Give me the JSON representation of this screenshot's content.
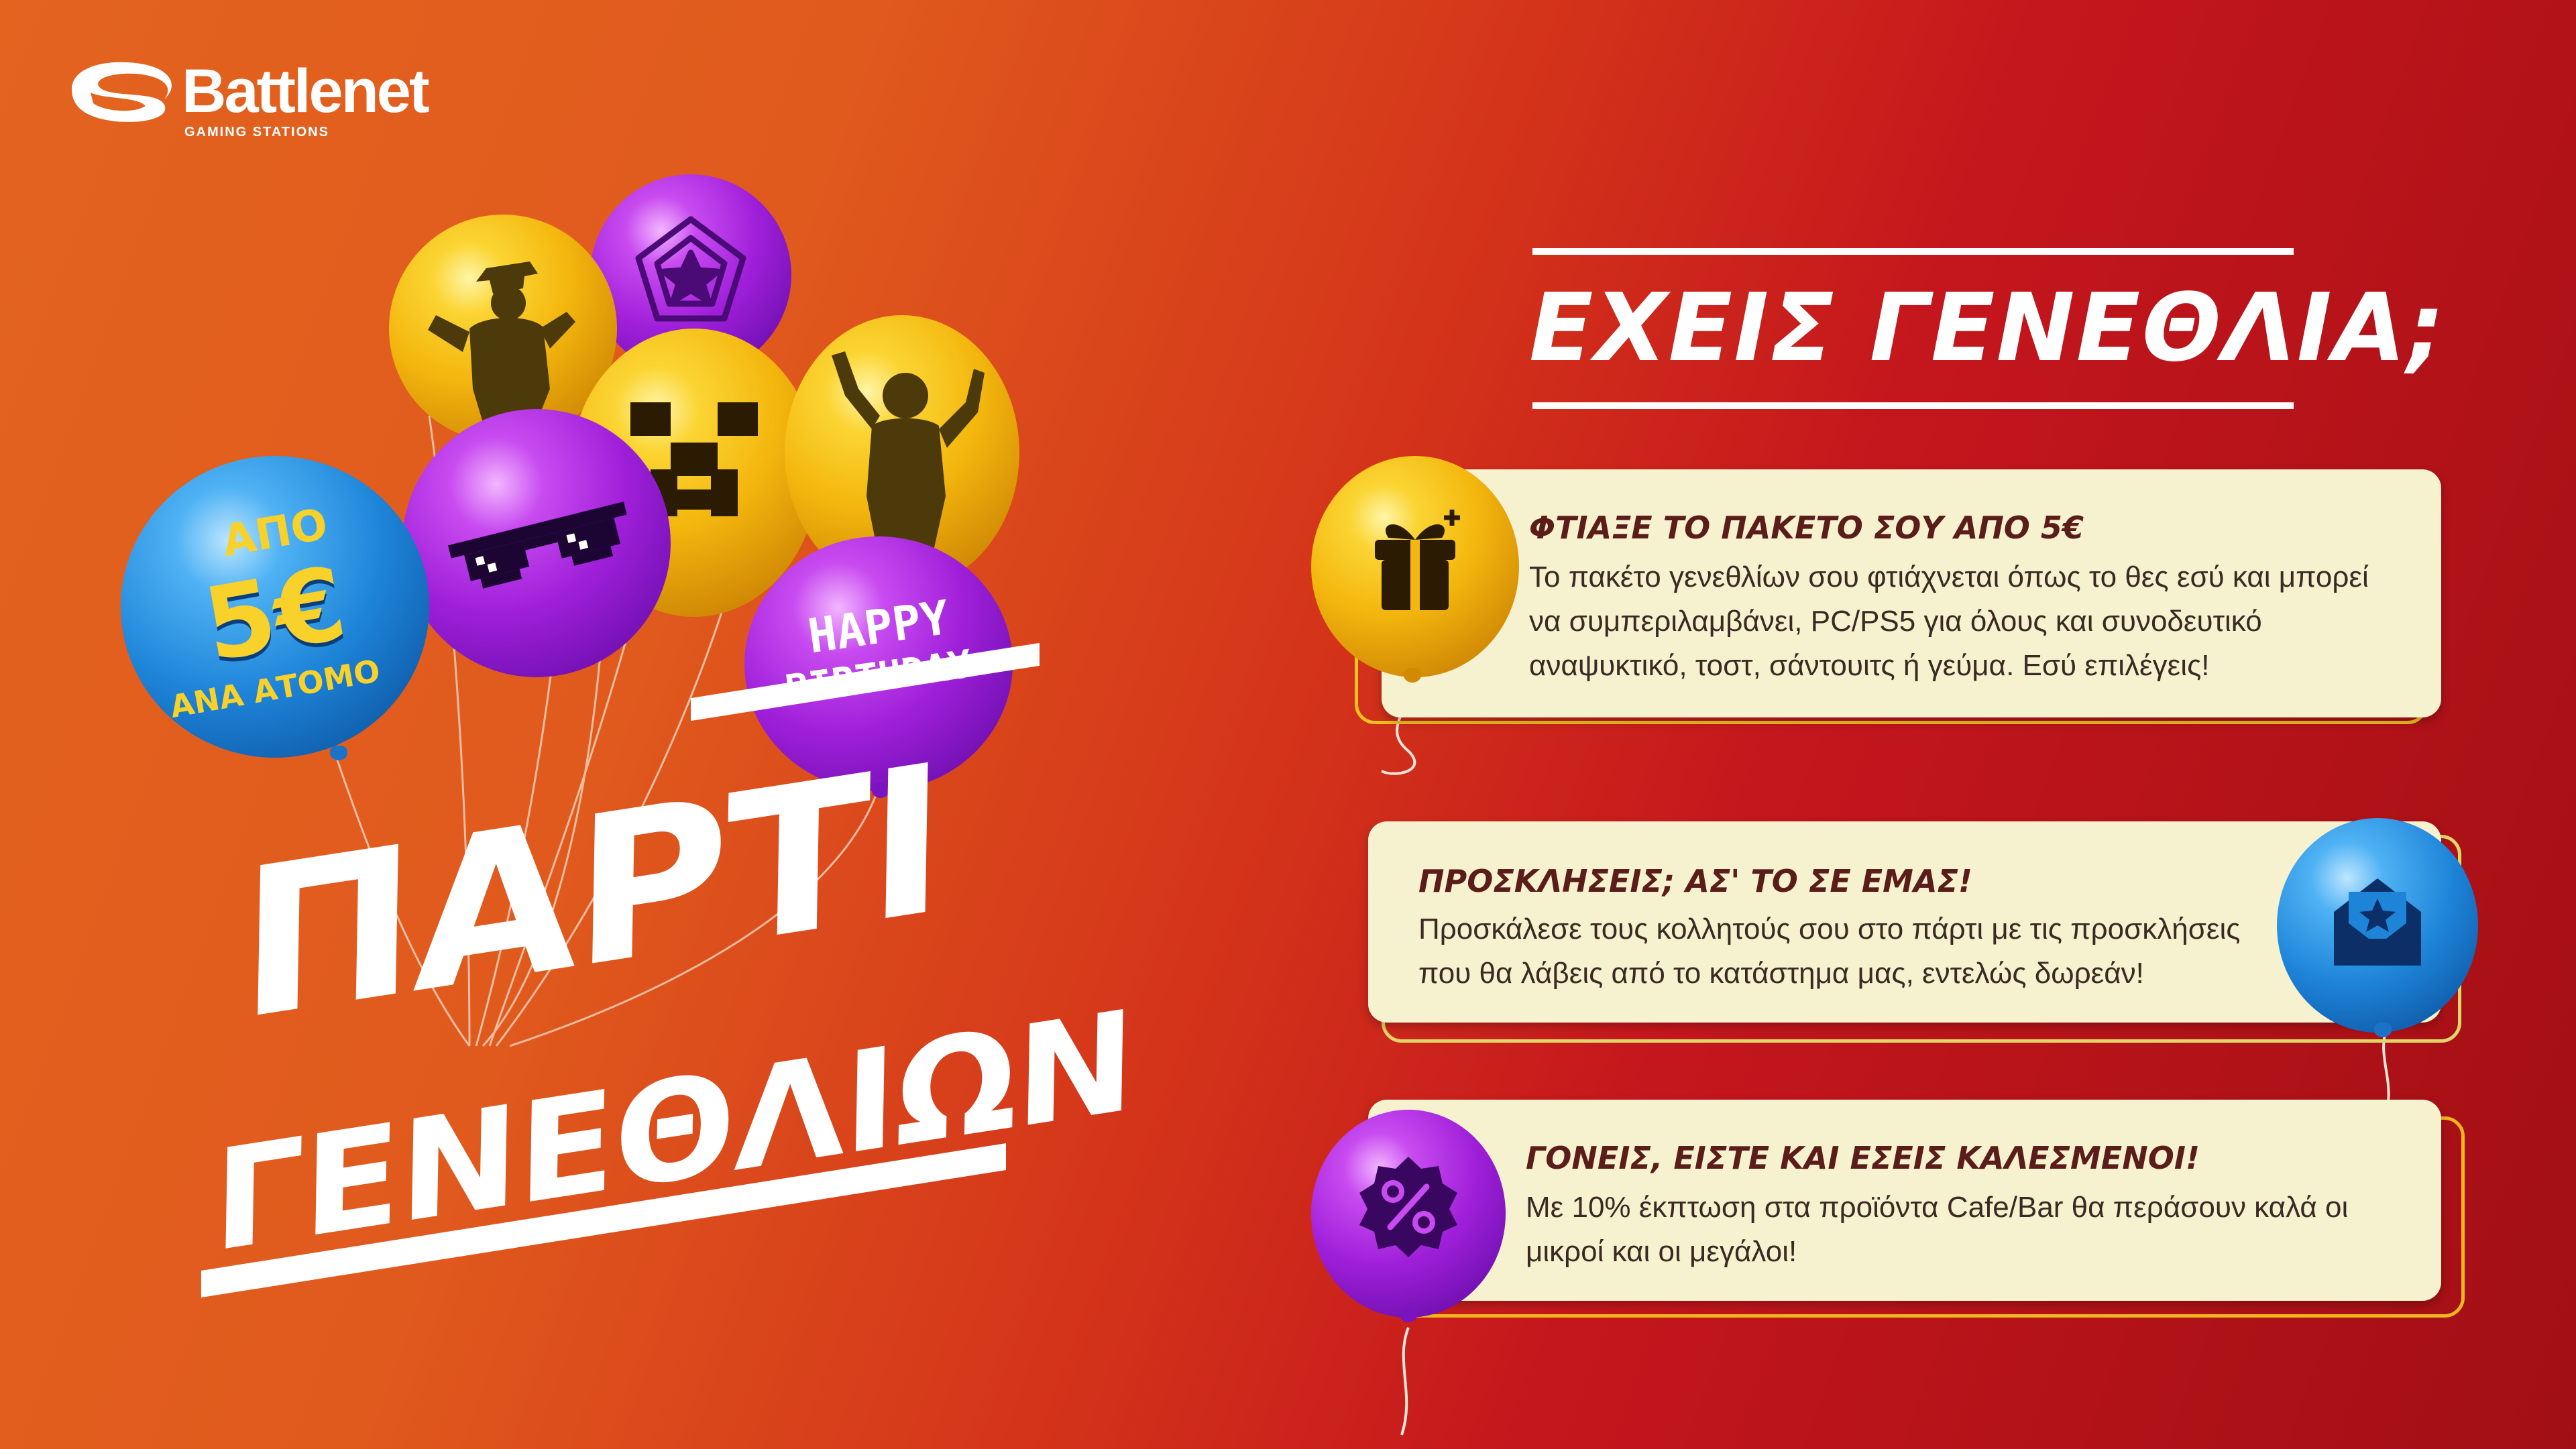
{
  "brand": {
    "name": "Battlenet",
    "tagline": "GAMING STATIONS",
    "registered": "®"
  },
  "colors": {
    "bg_left": "#e3631f",
    "bg_right": "#a10f14",
    "card_bg": "#f6f1cf",
    "price_yellow": "#f9d12b",
    "title_white": "#ffffff"
  },
  "price_balloon": {
    "top": "ΑΠΟ",
    "amount": "5€",
    "bottom": "ΑΝΑ ΑΤΟΜΟ"
  },
  "birthday_balloon": {
    "line1": "HAPPY",
    "line2": "BIRTHDAY"
  },
  "title": {
    "line1": "ΠΑΡΤΙ",
    "line2": "ΓΕΝΕΘΛΙΩΝ"
  },
  "header": {
    "title": "ΕΧΕΙΣ ΓΕΝΕΘΛΙΑ;"
  },
  "cards": [
    {
      "icon": "gift-icon",
      "title": "ΦΤΙΑΞΕ ΤΟ ΠΑΚΕΤΟ ΣΟΥ ΑΠΟ 5€",
      "text": "Το πακέτο γενεθλίων σου φτιάχνεται όπως το θες εσύ και μπορεί να συμπεριλαμβάνει, PC/PS5 για όλους και συνοδευτικό αναψυκτικό, τοστ, σάντουιτς ή γεύμα. Εσύ επιλέγεις!"
    },
    {
      "icon": "invitation-envelope-icon",
      "title": "ΠΡΟΣΚΛΗΣΕΙΣ; ΑΣ' ΤΟ ΣΕ ΕΜΑΣ!",
      "text": "Προσκάλεσε τους κολλητούς σου στο πάρτι με τις προσκλήσεις που θα λάβεις από το κατάστημα μας, εντελώς δωρεάν!"
    },
    {
      "icon": "percent-badge-icon",
      "title": "ΓΟΝΕΙΣ, ΕΙΣΤΕ ΚΑΙ ΕΣΕΙΣ ΚΑΛΕΣΜΕΝΟΙ!",
      "text": "Με 10% έκπτωση στα προϊόντα Cafe/Bar θα περάσουν καλά οι μικροί και οι μεγάλοι!"
    }
  ]
}
